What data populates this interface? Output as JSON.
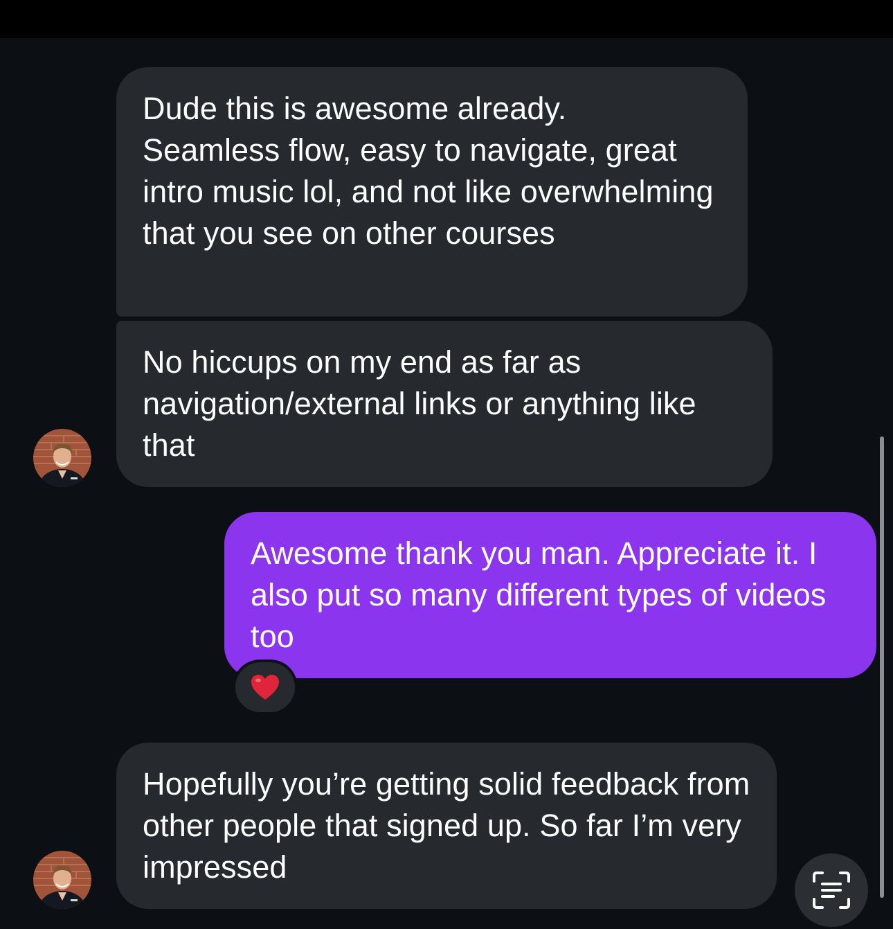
{
  "messages": [
    {
      "direction": "incoming",
      "text": "Dude this is awesome already.\nSeamless flow, easy to navigate, great intro music lol, and not like overwhelming that you see on other courses"
    },
    {
      "direction": "incoming",
      "text": "No hiccups on my end as far as navigation/external links or anything like that"
    },
    {
      "direction": "outgoing",
      "text": "Awesome thank you man. Appreciate it. I also put so many different types of videos too",
      "reaction": "heart-icon"
    },
    {
      "direction": "incoming",
      "text": "Hopefully you’re getting solid feedback from other people that signed up. So far I’m very impressed"
    }
  ],
  "colors": {
    "background": "#0c0f13",
    "incoming_bubble": "#26292e",
    "outgoing_bubble": "#8b35ef",
    "reaction_heart": "#e0243a"
  },
  "icons": {
    "reaction": "heart-icon",
    "scan_button": "live-text-scan-icon"
  }
}
